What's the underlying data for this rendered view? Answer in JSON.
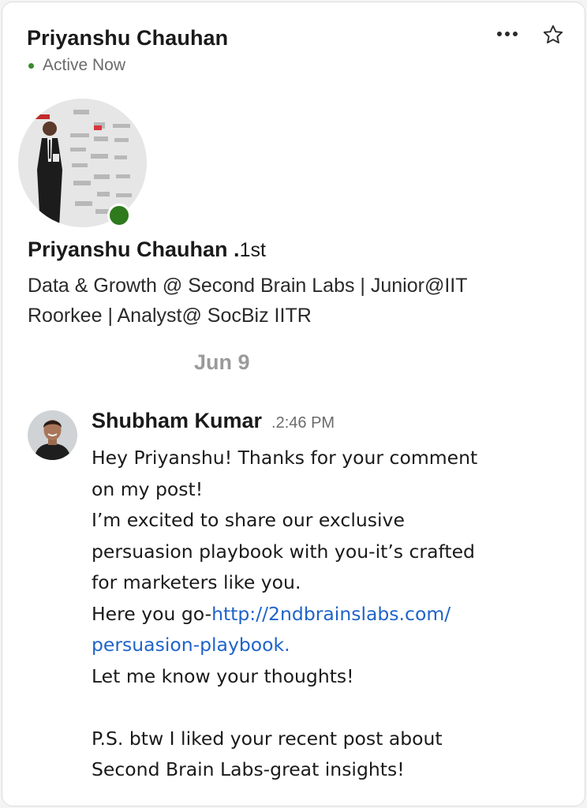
{
  "header": {
    "name": "Priyanshu Chauhan",
    "status": "Active Now",
    "status_color": "#3a8a2b"
  },
  "icons": {
    "more": "more-horizontal-icon",
    "star": "star-outline-icon"
  },
  "profile": {
    "name": "Priyanshu Chauhan .",
    "degree": "1st",
    "headline_line1": "Data & Growth @ Second Brain Labs | Junior@IIT",
    "headline_line2": "Roorkee | Analyst@ SocBiz IITR",
    "online_color": "#2e7a1d"
  },
  "date_separator": "Jun 9",
  "message": {
    "sender": "Shubham Kumar",
    "time": ".2:46 PM",
    "lines": {
      "l1": "Hey Priyanshu! Thanks for your comment",
      "l2": "on my post!",
      "l3": "I’m excited to share our exclusive",
      "l4": "persuasion playbook with you-it’s crafted",
      "l5": "for marketers like you.",
      "l6_prefix": "Here you go-",
      "l6_link": "http://2ndbrainslabs.com/",
      "l7_link": "persuasion-playbook.",
      "l8": "Let me know your thoughts!",
      "l9": "P.S. btw I liked your recent post about",
      "l10": "Second Brain Labs-great insights!"
    },
    "link_color": "#1f63c9"
  }
}
